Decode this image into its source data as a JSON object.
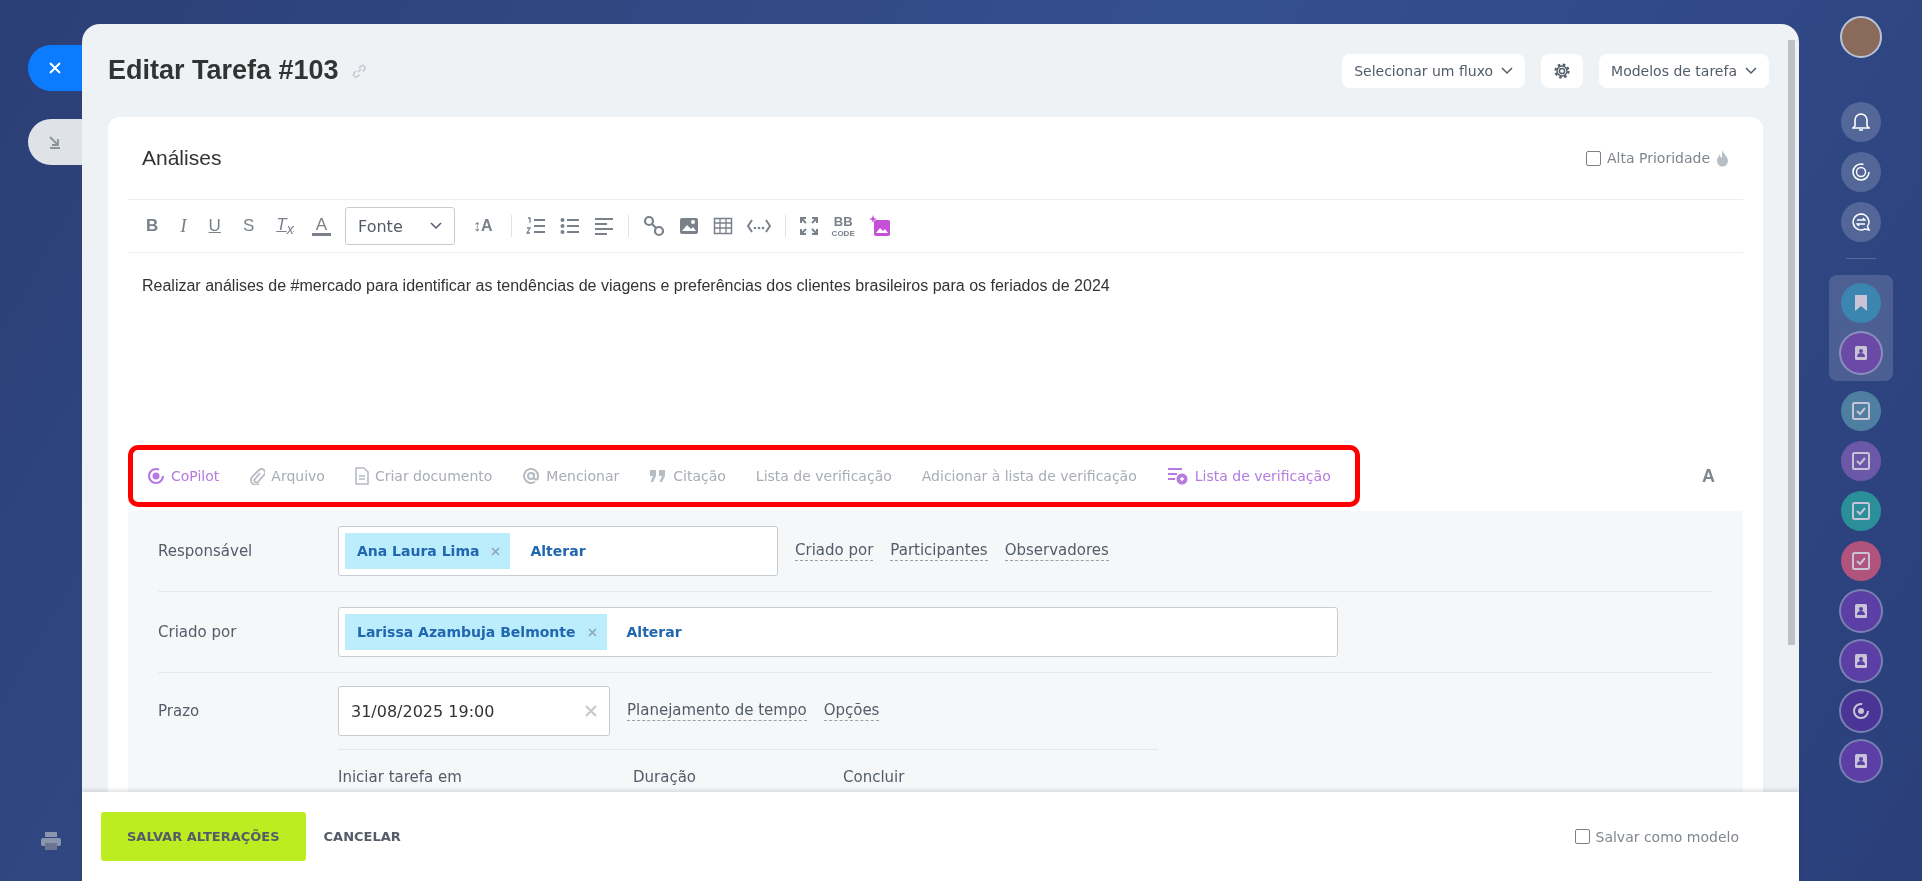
{
  "window": {
    "title": "Editar Tarefa #103"
  },
  "header_controls": {
    "flow_select": "Selecionar um fluxo",
    "templates_select": "Modelos de tarefa"
  },
  "task": {
    "title": "Análises",
    "high_priority": {
      "label": "Alta Prioridade",
      "checked": false
    },
    "description": "Realizar análises de #mercado para identificar as tendências de viagens e preferências dos clientes brasileiros para os feriados de 2024"
  },
  "editor_toolbar": {
    "format_buttons": [
      {
        "glyph": "B",
        "kind": "bold"
      },
      {
        "glyph": "I",
        "kind": "italic"
      },
      {
        "glyph": "U",
        "kind": "underline"
      },
      {
        "glyph": "S",
        "kind": "strike"
      },
      {
        "glyph": "T$_{x}$",
        "kind": "clear"
      },
      {
        "glyph": "A",
        "kind": "color"
      }
    ],
    "font_select": "Fonte",
    "size_glyph": "↕A",
    "bbcode": {
      "top": "BB",
      "bottom": "CODE"
    }
  },
  "attachment_bar": {
    "items": [
      {
        "label": "CoPilot",
        "kind": "copilot"
      },
      {
        "label": "Arquivo",
        "kind": "file"
      },
      {
        "label": "Criar documento",
        "kind": "document"
      },
      {
        "label": "Mencionar",
        "kind": "mention"
      },
      {
        "label": "Citação",
        "kind": "quote"
      },
      {
        "label": "Lista de verificação",
        "kind": "plain"
      },
      {
        "label": "Adicionar à lista de verificação",
        "kind": "plain"
      },
      {
        "label": "Lista de verificação",
        "kind": "ai_checklist"
      }
    ],
    "font_toggle": "A"
  },
  "fields": {
    "responsible": {
      "label": "Responsável",
      "people": [
        "Ana Laura Lima"
      ],
      "change": "Alterar",
      "links": [
        "Criado por",
        "Participantes",
        "Observadores"
      ]
    },
    "created_by": {
      "label": "Criado por",
      "people": [
        "Larissa Azambuja Belmonte"
      ],
      "change": "Alterar"
    },
    "deadline": {
      "label": "Prazo",
      "value": "31/08/2025 19:00",
      "links": [
        "Planejamento de tempo",
        "Opções"
      ],
      "sub_labels": [
        "Iniciar tarefa em",
        "Duração",
        "Concluir"
      ]
    }
  },
  "footer": {
    "save": "SALVAR ALTERAÇÕES",
    "cancel": "CANCELAR",
    "save_template": {
      "label": "Salvar como modelo",
      "checked": false
    }
  }
}
